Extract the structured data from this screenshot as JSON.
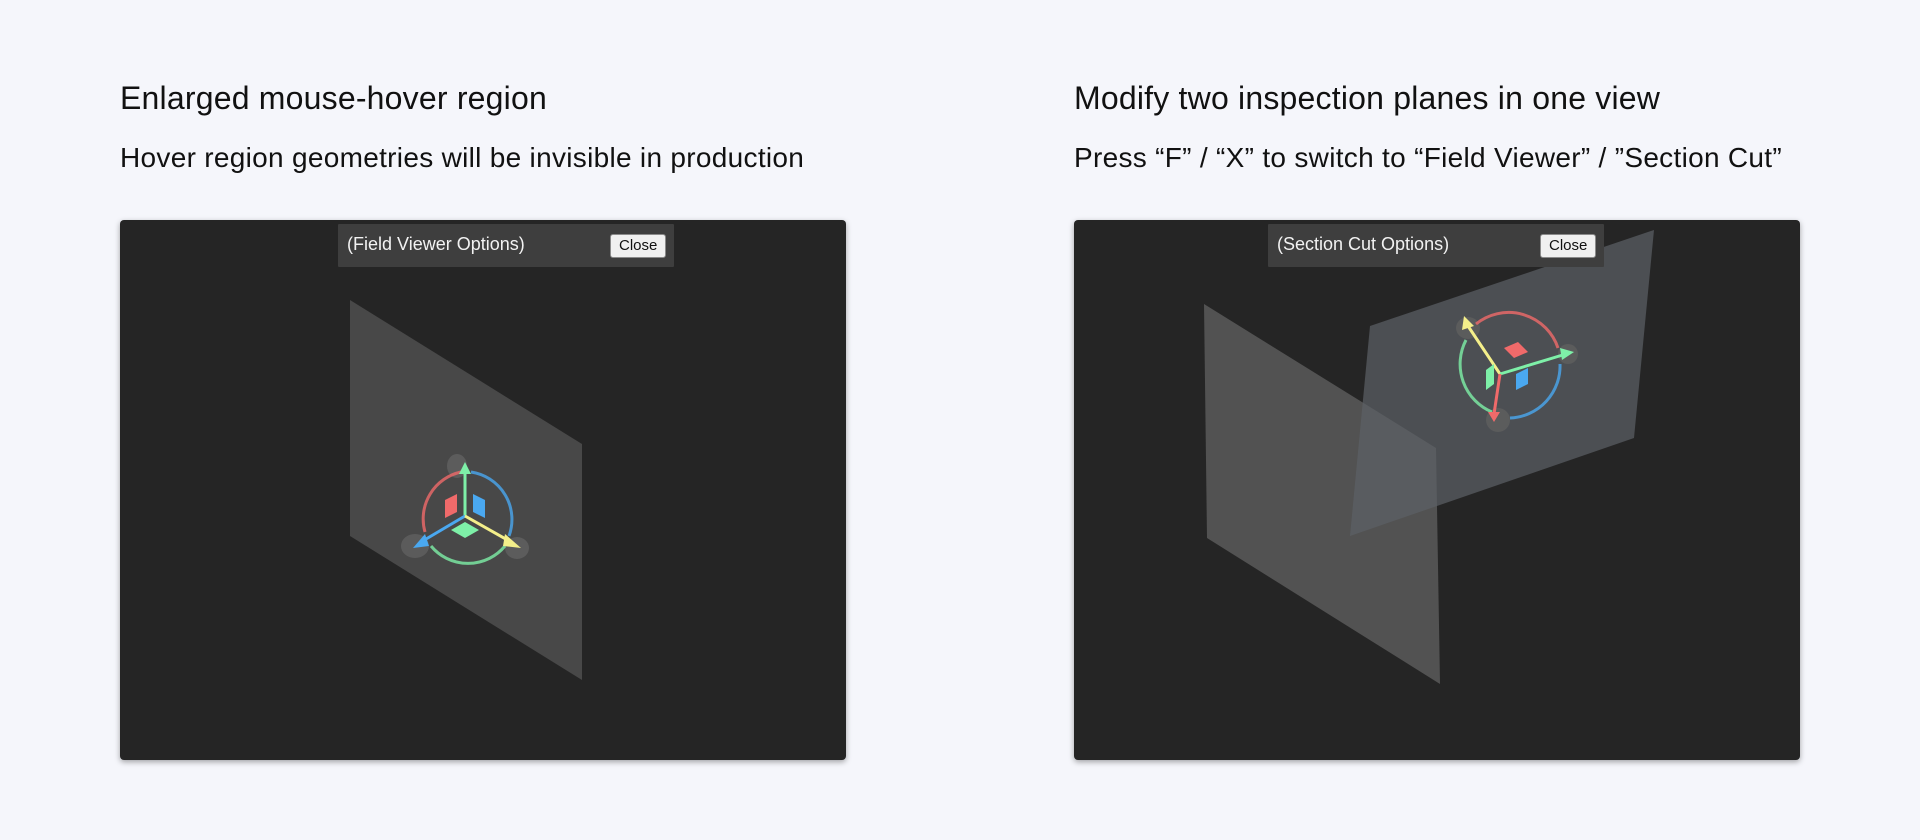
{
  "left": {
    "title": "Enlarged mouse-hover region",
    "subtitle": "Hover region geometries will be invisible in production",
    "options_label": "(Field Viewer Options)",
    "close_label": "Close"
  },
  "right": {
    "title": "Modify two inspection planes in one view",
    "subtitle": "Press “F” / “X” to switch to “Field Viewer” / ”Section Cut”",
    "options_label": "(Section Cut Options)",
    "close_label": "Close"
  },
  "colors": {
    "background": "#f5f6fb",
    "viewport": "#252525",
    "panel": "#3e3e3e",
    "axis_red": "#f06a6a",
    "axis_green": "#7ef0a8",
    "axis_blue": "#4aa8f0",
    "axis_yellow": "#f4ef8a"
  },
  "icons": [
    "transform-gizmo-icon",
    "hover-region-icon"
  ]
}
